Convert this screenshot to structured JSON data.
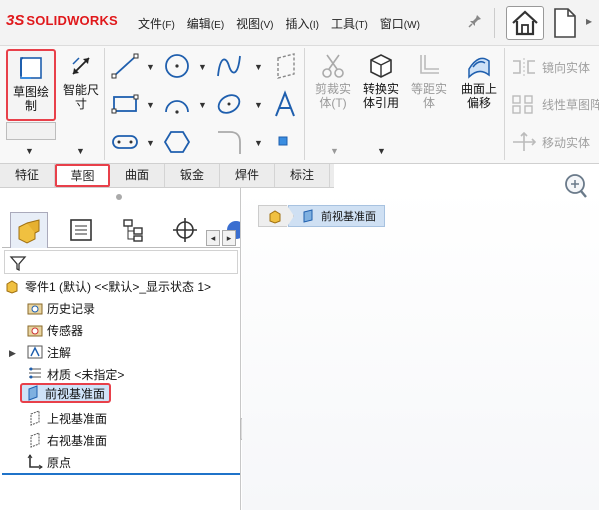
{
  "app": {
    "brand_ds": "3S",
    "brand_name": "SOLIDWORKS"
  },
  "menu": [
    {
      "label": "文件",
      "key": "(F)"
    },
    {
      "label": "编辑",
      "key": "(E)"
    },
    {
      "label": "视图",
      "key": "(V)"
    },
    {
      "label": "插入",
      "key": "(I)"
    },
    {
      "label": "工具",
      "key": "(T)"
    },
    {
      "label": "窗口",
      "key": "(W)"
    }
  ],
  "ribbon": {
    "sketch_btn": {
      "line1": "草图绘",
      "line2": "制"
    },
    "smart_dim": {
      "line1": "智能尺",
      "line2": "寸"
    },
    "trim": {
      "line1": "剪裁实",
      "line2": "体(T)"
    },
    "convert": {
      "line1": "转换实",
      "line2": "体引用"
    },
    "offset": {
      "line1": "等距实",
      "line2": "体"
    },
    "surface_offset": {
      "line1": "曲面上",
      "line2": "偏移"
    },
    "mirror": "镜向实体",
    "linear_pattern": "线性草图阵",
    "move": "移动实体"
  },
  "tabs": [
    "特征",
    "草图",
    "曲面",
    "钣金",
    "焊件",
    "标注"
  ],
  "active_tab": "草图",
  "tree": {
    "root": "零件1 (默认) <<默认>_显示状态 1>",
    "items": {
      "history": "历史记录",
      "sensors": "传感器",
      "annotations": "注解",
      "material": "材质 <未指定>",
      "front_plane": "前视基准面",
      "top_plane": "上视基准面",
      "right_plane": "右视基准面",
      "origin": "原点"
    }
  },
  "breadcrumb": {
    "item": "前视基准面"
  },
  "colors": {
    "highlight": "#e8404a",
    "selection": "#cfe2f7",
    "brand": "#e0181b"
  }
}
